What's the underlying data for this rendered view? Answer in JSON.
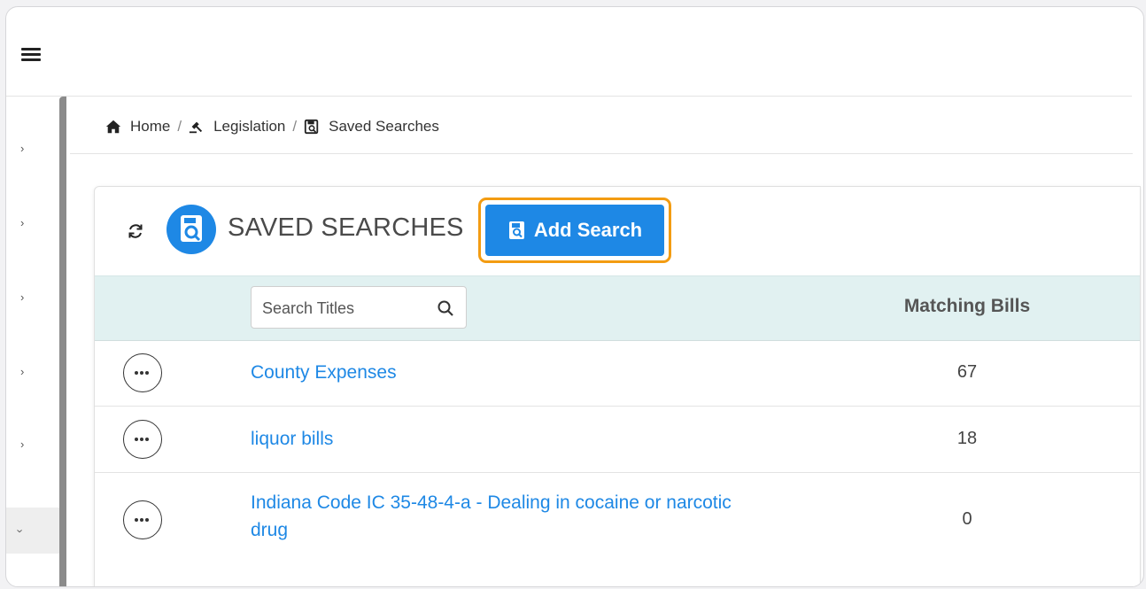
{
  "breadcrumb": {
    "home": "Home",
    "legislation": "Legislation",
    "saved_searches": "Saved Searches",
    "separator": "/"
  },
  "panel": {
    "title": "SAVED SEARCHES",
    "add_button_label": "Add Search"
  },
  "table": {
    "search_placeholder": "Search Titles",
    "matching_header": "Matching Bills",
    "rows": [
      {
        "title": "County Expenses",
        "matching": "67"
      },
      {
        "title": "liquor bills",
        "matching": "18"
      },
      {
        "title": "Indiana Code IC 35-48-4-a - Dealing in cocaine or narcotic drug",
        "matching": "0"
      }
    ]
  },
  "icons": {
    "menu": "hamburger-icon",
    "home": "home-icon",
    "legislation": "gavel-icon",
    "saved": "save-search-icon",
    "refresh": "refresh-icon",
    "search": "search-icon",
    "row_menu": "ellipsis-icon"
  },
  "colors": {
    "accent": "#1e88e5",
    "highlight": "#f39c12",
    "table_header_bg": "#e1f1f1"
  }
}
